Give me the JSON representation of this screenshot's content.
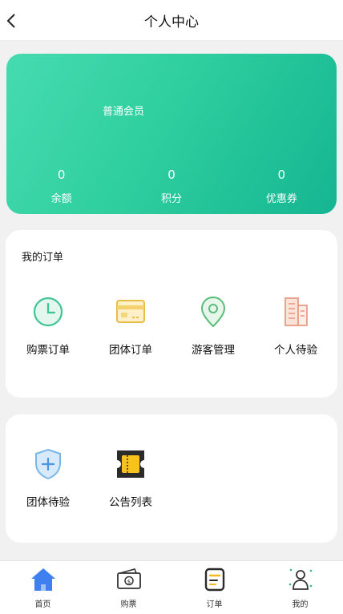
{
  "header": {
    "title": "个人中心"
  },
  "member": {
    "level": "普通会员",
    "stats": [
      {
        "value": "0",
        "label": "余额"
      },
      {
        "value": "0",
        "label": "积分"
      },
      {
        "value": "0",
        "label": "优惠券"
      }
    ]
  },
  "orders": {
    "title": "我的订单",
    "items": [
      {
        "label": "购票订单",
        "icon": "clock-icon"
      },
      {
        "label": "团体订单",
        "icon": "card-icon"
      },
      {
        "label": "游客管理",
        "icon": "location-pin-icon"
      },
      {
        "label": "个人待验",
        "icon": "building-icon"
      }
    ]
  },
  "verify": {
    "items": [
      {
        "label": "团体待验",
        "icon": "shield-plus-icon"
      },
      {
        "label": "公告列表",
        "icon": "ticket-icon"
      }
    ]
  },
  "tabbar": {
    "items": [
      {
        "label": "首页",
        "icon": "home-icon",
        "active": true
      },
      {
        "label": "购票",
        "icon": "cash-icon"
      },
      {
        "label": "订单",
        "icon": "order-icon"
      },
      {
        "label": "我的",
        "icon": "person-icon"
      }
    ]
  },
  "colors": {
    "card_gradient_start": "#46dbb0",
    "card_gradient_end": "#15b592",
    "accent_blue": "#3f7ff0"
  }
}
